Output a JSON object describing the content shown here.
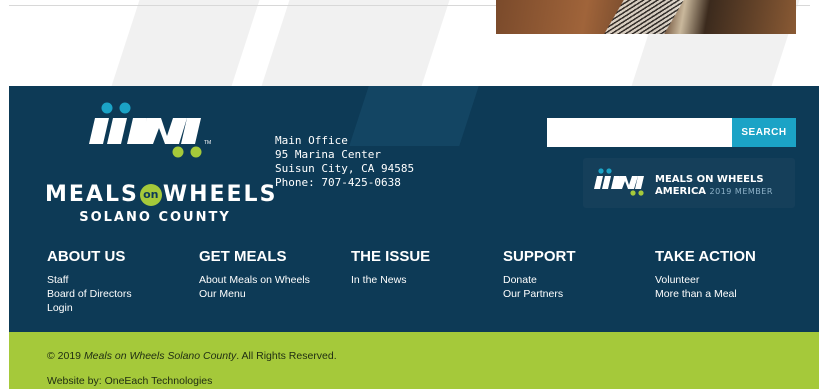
{
  "colors": {
    "footer_bg": "#0d3a56",
    "accent_green": "#a5c93a",
    "accent_teal": "#1ba3c6"
  },
  "logo": {
    "icon": "meals-on-wheels-logo-icon",
    "word_left": "MEALS",
    "word_on": "on",
    "word_right": "WHEELS",
    "subtitle": "SOLANO COUNTY"
  },
  "address": {
    "label": "Main Office",
    "street": "95 Marina Center",
    "city": "Suisun City, CA 94585",
    "phone": "Phone: 707-425-0638"
  },
  "search": {
    "placeholder": "",
    "value": "",
    "button_label": "SEARCH"
  },
  "badge": {
    "icon": "meals-on-wheels-america-logo-icon",
    "line1": "MEALS ON WHEELS",
    "line2": "AMERICA",
    "line2_suffix": "2019 MEMBER"
  },
  "columns": [
    {
      "heading": "ABOUT US",
      "links": [
        "Staff",
        "Board of Directors",
        "Login"
      ]
    },
    {
      "heading": "GET MEALS",
      "links": [
        "About Meals on Wheels",
        "Our Menu"
      ]
    },
    {
      "heading": "THE ISSUE",
      "links": [
        "In the News"
      ]
    },
    {
      "heading": "SUPPORT",
      "links": [
        "Donate",
        "Our Partners"
      ]
    },
    {
      "heading": "TAKE ACTION",
      "links": [
        "Volunteer",
        "More than a Meal"
      ]
    }
  ],
  "bottom": {
    "copyright_prefix": "© 2019",
    "copyright_org": "Meals on Wheels Solano County",
    "copyright_suffix": ". All Rights Reserved.",
    "credit": "Website by: OneEach Technologies"
  }
}
